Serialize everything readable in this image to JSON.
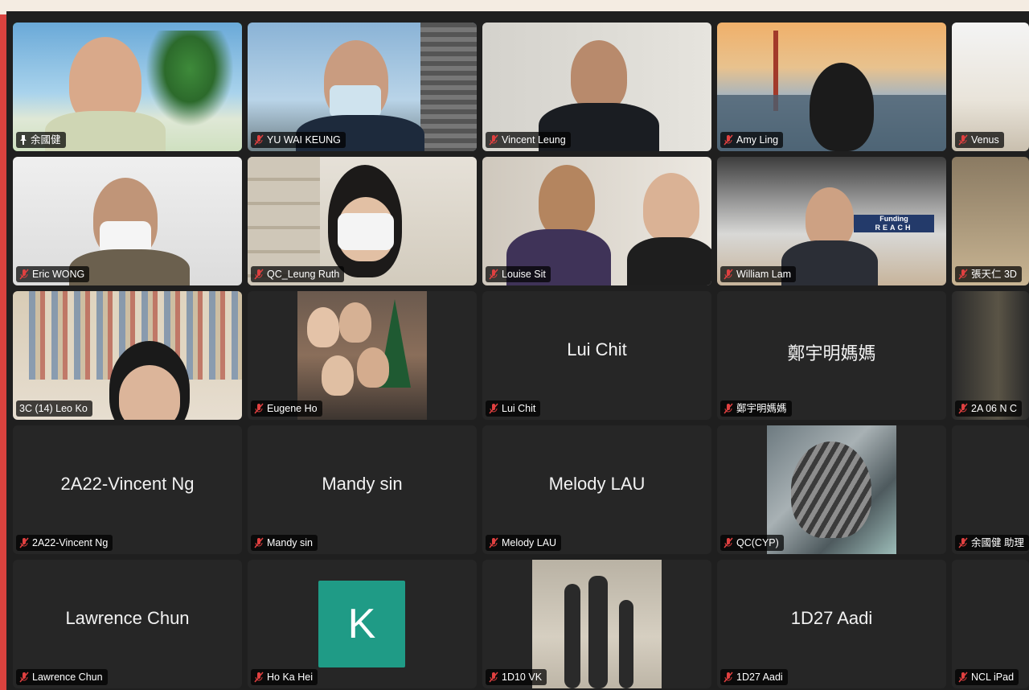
{
  "tiles": [
    {
      "name": "余國健",
      "label": "余國健",
      "muted": false,
      "pinned": true
    },
    {
      "name": "YU WAI KEUNG",
      "label": "YU WAI KEUNG",
      "muted": true
    },
    {
      "name": "Vincent Leung",
      "label": "Vincent Leung",
      "muted": true
    },
    {
      "name": "Amy Ling",
      "label": "Amy Ling",
      "muted": true
    },
    {
      "name": "Venus",
      "label": "Venus",
      "muted": true
    },
    {
      "name": "Eric WONG",
      "label": "Eric WONG",
      "muted": true
    },
    {
      "name": "QC_Leung Ruth",
      "label": "QC_Leung Ruth",
      "muted": true
    },
    {
      "name": "Louise Sit",
      "label": "Louise Sit",
      "muted": true
    },
    {
      "name": "William Lam",
      "label": "William Lam",
      "muted": true
    },
    {
      "name": "張天仁 3D",
      "label": "張天仁 3D",
      "muted": true
    },
    {
      "name": "3C (14) Leo Ko",
      "label": "3C (14) Leo Ko",
      "muted": false
    },
    {
      "name": "Eugene Ho",
      "label": "Eugene Ho",
      "muted": true
    },
    {
      "name": "Lui Chit",
      "label": "Lui Chit",
      "display": "Lui Chit",
      "muted": true
    },
    {
      "name": "鄭宇明媽媽",
      "label": "鄭宇明媽媽",
      "display": "鄭宇明媽媽",
      "muted": true
    },
    {
      "name": "2A 06 N C",
      "label": "2A 06 N C",
      "muted": true
    },
    {
      "name": "2A22-Vincent Ng",
      "label": "2A22-Vincent Ng",
      "display": "2A22-Vincent Ng",
      "muted": true
    },
    {
      "name": "Mandy sin",
      "label": "Mandy sin",
      "display": "Mandy sin",
      "muted": true
    },
    {
      "name": "Melody LAU",
      "label": "Melody LAU",
      "display": "Melody LAU",
      "muted": true
    },
    {
      "name": "QC(CYP)",
      "label": "QC(CYP)",
      "muted": true
    },
    {
      "name": "余國健 助理",
      "label": "余國健 助理",
      "muted": true
    },
    {
      "name": "Lawrence Chun",
      "label": "Lawrence Chun",
      "display": "Lawrence Chun",
      "muted": true
    },
    {
      "name": "Ho Ka Hei",
      "label": "Ho Ka Hei",
      "avatar_letter": "K",
      "muted": true
    },
    {
      "name": "1D10 VK",
      "label": "1D10 VK",
      "muted": true
    },
    {
      "name": "1D27 Aadi",
      "label": "1D27 Aadi",
      "display": "1D27 Aadi",
      "muted": true
    },
    {
      "name": "NCL iPad",
      "label": "NCL iPad",
      "muted": true
    }
  ],
  "wall_sign": {
    "line1": "Funding",
    "line2": "REACH"
  },
  "colors": {
    "active_border": "#2ecc40",
    "muted_icon": "#e04040",
    "avatar_k": "#1f9b86",
    "frame_red": "#d9423e"
  }
}
